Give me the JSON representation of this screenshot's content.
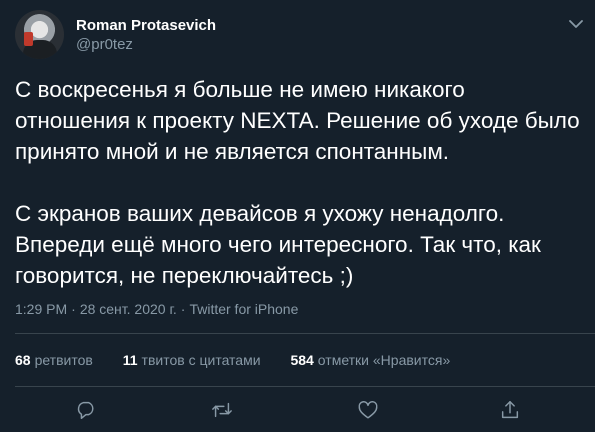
{
  "author": {
    "name": "Roman Protasevich",
    "handle": "@pr0tez"
  },
  "tweet": {
    "lines": [
      "С воскресенья я больше не имею никакого",
      "отношения к проекту NEXTA. Решение об уходе было",
      "принято мной и не является спонтанным.",
      "С экранов ваших девайсов я ухожу ненадолго.",
      "Впереди ещё много чего интересного. Так что, как",
      "говорится, не переключайтесь ;)"
    ],
    "time": "1:29 PM",
    "date": "28 сент. 2020 г.",
    "separator": "·",
    "source": "Twitter for iPhone"
  },
  "stats": {
    "retweets_count": "68",
    "retweets_label": "ретвитов",
    "quotes_count": "11",
    "quotes_label": "твитов с цитатами",
    "likes_count": "584",
    "likes_label": "отметки «Нравится»"
  },
  "icons": {
    "caret": "chevron-down-icon",
    "reply": "reply-icon",
    "retweet": "retweet-icon",
    "like": "heart-icon",
    "share": "share-icon"
  },
  "colors": {
    "background": "#15202b",
    "text": "#ffffff",
    "secondary": "#8899a6",
    "divider": "#38444d"
  }
}
